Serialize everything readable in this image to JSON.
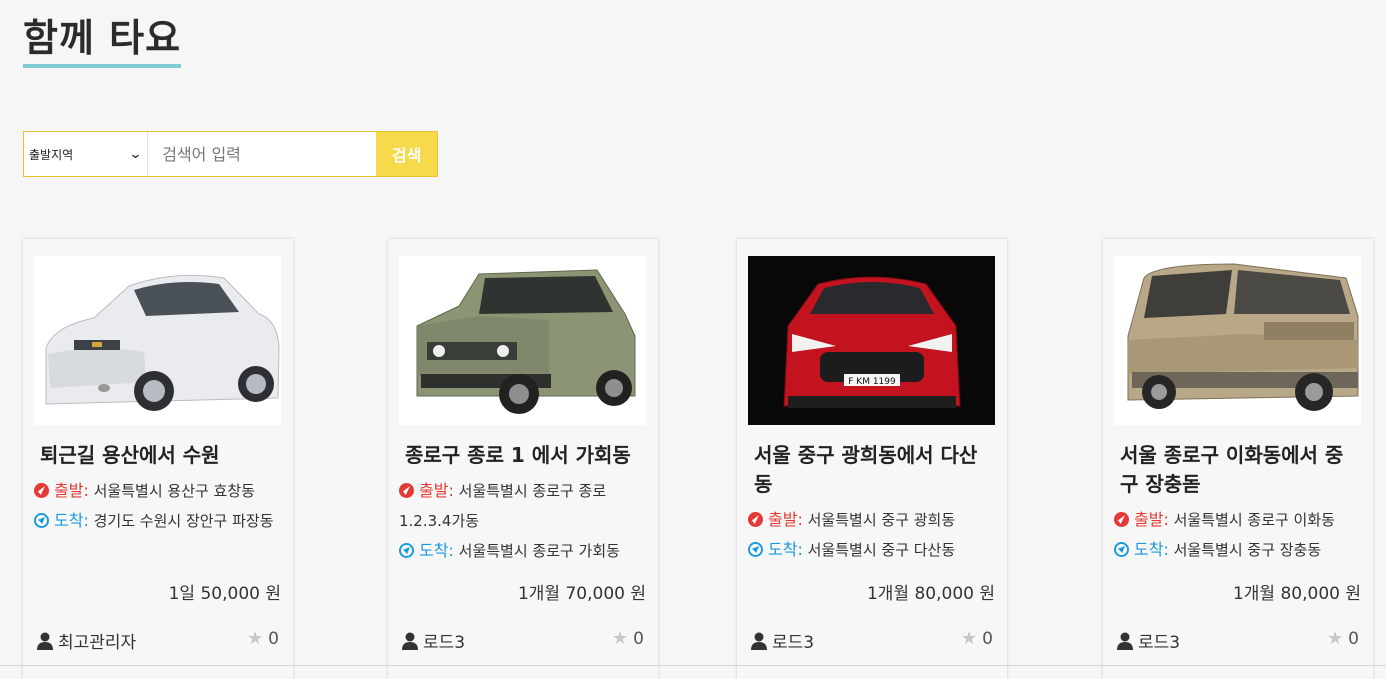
{
  "header": {
    "title": "함께 타요"
  },
  "search": {
    "region_label": "출발지역",
    "placeholder": "검색어 입력",
    "button_label": "검색"
  },
  "labels": {
    "departure": "출발:",
    "arrival": "도착:"
  },
  "colors": {
    "accent_underline": "#7fcbd6",
    "search_button": "#f7d94c",
    "departure": "#e53935",
    "arrival": "#1a9ae0"
  },
  "cards": [
    {
      "title": "퇴근길 용산에서 수원",
      "departure": "서울특별시 용산구 효창동",
      "arrival": "경기도 수원시 장안구 파장동",
      "price": "1일 50,000 원",
      "owner": "최고관리자",
      "likes": "0",
      "image": "silver-sedan"
    },
    {
      "title": "종로구 종로 1 에서 가회동",
      "departure": "서울특별시 종로구 종로 1.2.3.4가동",
      "arrival": "서울특별시 종로구 가회동",
      "price": "1개월 70,000 원",
      "owner": "로드3",
      "likes": "0",
      "image": "green-suv"
    },
    {
      "title": "서울 중구 광희동에서 다산동",
      "departure": "서울특별시 중구 광희동",
      "arrival": "서울특별시 중구 다산동",
      "price": "1개월 80,000 원",
      "owner": "로드3",
      "likes": "0",
      "image": "red-sports-car",
      "plate": "F KM 1199"
    },
    {
      "title": "서울 종로구 이화동에서 중구 장충돋",
      "departure": "서울특별시 종로구 이화동",
      "arrival": "서울특별시 중구 장충동",
      "price": "1개월 80,000 원",
      "owner": "로드3",
      "likes": "0",
      "image": "beige-minivan"
    }
  ]
}
